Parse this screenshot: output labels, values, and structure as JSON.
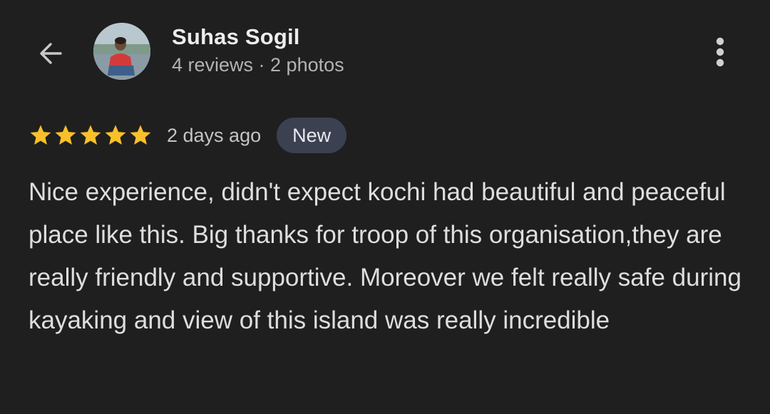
{
  "header": {
    "back_icon": "arrow-left-icon",
    "more_icon": "more-vert-icon",
    "user_name": "Suhas Sogil",
    "user_meta": "4 reviews · 2 photos"
  },
  "review": {
    "rating": 5,
    "rating_max": 5,
    "star_color": "#f9c02b",
    "time": "2 days ago",
    "badge": "New",
    "text": "Nice experience, didn't expect kochi had beautiful and peaceful place like this. Big thanks for troop of this organisation,they are really friendly and supportive. Moreover we felt really safe during kayaking and view of this island was really incredible"
  }
}
